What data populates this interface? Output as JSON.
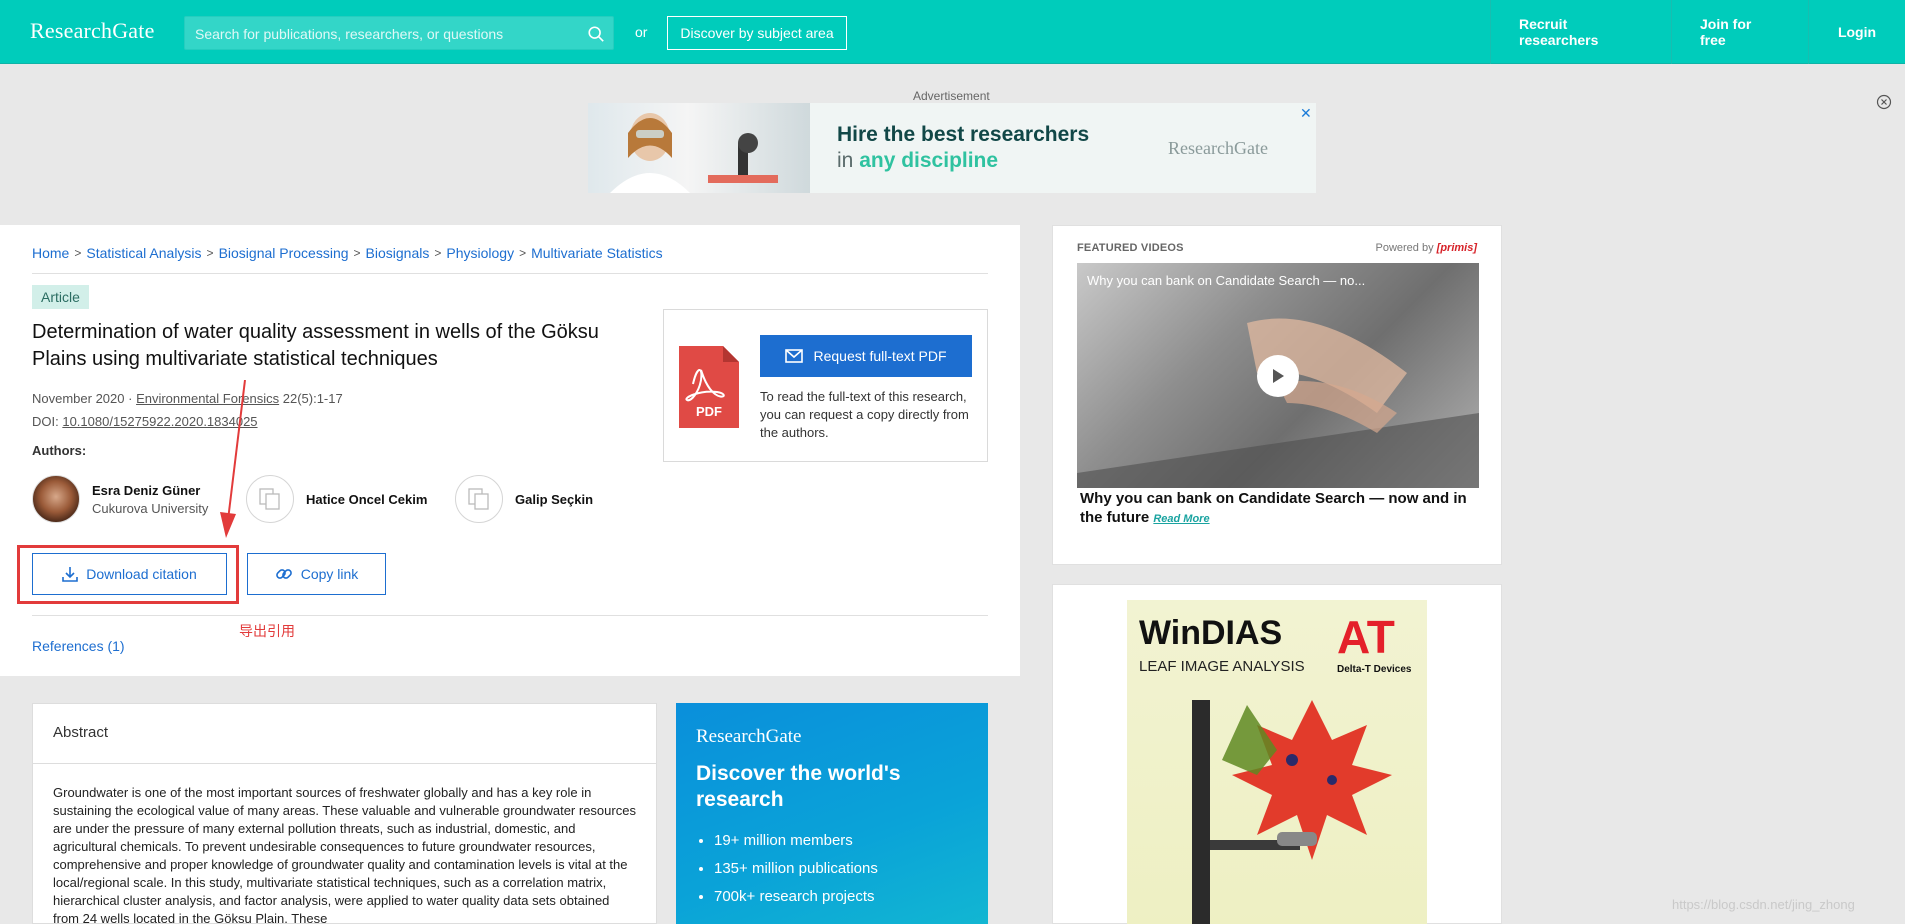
{
  "header": {
    "logo": "ResearchGate",
    "search_placeholder": "Search for publications, researchers, or questions",
    "or_text": "or",
    "discover_label": "Discover by subject area",
    "nav": {
      "recruit": "Recruit researchers",
      "join": "Join for free",
      "login": "Login"
    },
    "accent_color": "#00ccbb"
  },
  "ad": {
    "label": "Advertisement",
    "headline": "Hire the best researchers",
    "sub_prefix": "in ",
    "sub_highlight": "any discipline",
    "brand": "ResearchGate",
    "close": "✕"
  },
  "breadcrumb": [
    "Home",
    "Statistical Analysis",
    "Biosignal Processing",
    "Biosignals",
    "Physiology",
    "Multivariate Statistics"
  ],
  "article": {
    "badge": "Article",
    "title": "Determination of water quality assessment in wells of the Göksu Plains using multivariate statistical techniques",
    "date": "November 2020 · ",
    "journal": "Environmental Forensics",
    "volume": " 22(5):1-17",
    "doi_label": "DOI: ",
    "doi": "10.1080/15275922.2020.1834025",
    "authors_label": "Authors:",
    "authors": [
      {
        "name": "Esra Deniz Güner",
        "affiliation": "Cukurova University"
      },
      {
        "name": "Hatice Oncel Cekim",
        "affiliation": ""
      },
      {
        "name": "Galip Seçkin",
        "affiliation": ""
      }
    ],
    "download_citation": "Download citation",
    "copy_link": "Copy link",
    "annotation": "导出引用",
    "references": "References (1)"
  },
  "pdf_box": {
    "request_label": "Request full-text PDF",
    "description": "To read the full-text of this research, you can request a copy directly from the authors.",
    "pdf_icon_text": "PDF"
  },
  "abstract": {
    "heading": "Abstract",
    "text": "Groundwater is one of the most important sources of freshwater globally and has a key role in sustaining the ecological value of many areas. These valuable and vulnerable groundwater resources are under the pressure of many external pollution threats, such as industrial, domestic, and agricultural chemicals. To prevent undesirable consequences to future groundwater resources, comprehensive and proper knowledge of groundwater quality and contamination levels is vital at the local/regional scale. In this study, multivariate statistical techniques, such as a correlation matrix, hierarchical cluster analysis, and factor analysis, were applied to water quality data sets obtained from 24 wells located in the Göksu Plain. These"
  },
  "promo": {
    "logo": "ResearchGate",
    "headline": "Discover the world's research",
    "bullets": [
      "19+ million members",
      "135+ million publications",
      "700k+ research projects"
    ]
  },
  "video": {
    "label": "FEATURED VIDEOS",
    "powered_prefix": "Powered by ",
    "powered_brand": "[primis]",
    "title_overlay": "Why you can bank on Candidate Search — no...",
    "caption": "Why you can bank on Candidate Search — now and in the future",
    "read_more": "Read More"
  },
  "ad2": {
    "title": "WinDIAS",
    "subtitle": "LEAF IMAGE ANALYSIS",
    "logo": "AT",
    "company": "Delta-T Devices"
  },
  "watermark": "https://blog.csdn.net/jing_zhong"
}
